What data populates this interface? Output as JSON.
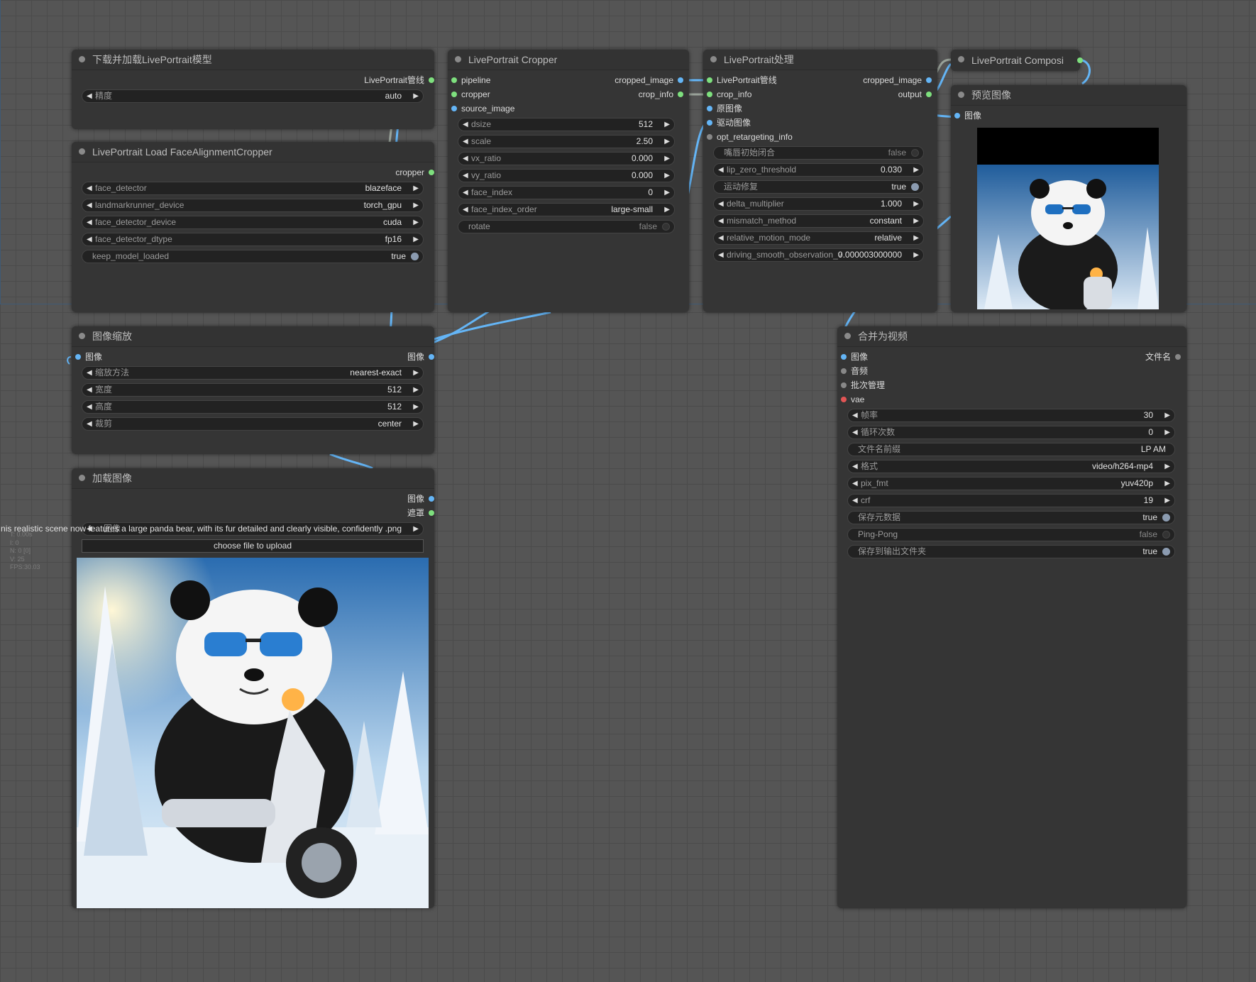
{
  "nodes": {
    "loader": {
      "title": "下载并加载LivePortrait模型",
      "output": "LivePortrait管线",
      "precision": {
        "label": "精度",
        "value": "auto"
      }
    },
    "face_cropper": {
      "title": "LivePortrait Load FaceAlignmentCropper",
      "output": "cropper",
      "face_detector": {
        "label": "face_detector",
        "value": "blazeface"
      },
      "landmarkrunner_device": {
        "label": "landmarkrunner_device",
        "value": "torch_gpu"
      },
      "face_detector_device": {
        "label": "face_detector_device",
        "value": "cuda"
      },
      "face_detector_dtype": {
        "label": "face_detector_dtype",
        "value": "fp16"
      },
      "keep_model_loaded": {
        "label": "keep_model_loaded",
        "value": "true"
      }
    },
    "cropper": {
      "title": "LivePortrait Cropper",
      "in_pipeline": "pipeline",
      "in_cropper": "cropper",
      "in_source_image": "source_image",
      "out_cropped_image": "cropped_image",
      "out_crop_info": "crop_info",
      "dsize": {
        "label": "dsize",
        "value": "512"
      },
      "scale": {
        "label": "scale",
        "value": "2.50"
      },
      "vx_ratio": {
        "label": "vx_ratio",
        "value": "0.000"
      },
      "vy_ratio": {
        "label": "vy_ratio",
        "value": "0.000"
      },
      "face_index": {
        "label": "face_index",
        "value": "0"
      },
      "face_index_order": {
        "label": "face_index_order",
        "value": "large-small"
      },
      "rotate": {
        "label": "rotate",
        "value": "false"
      }
    },
    "process": {
      "title": "LivePortrait处理",
      "in_pipeline": "LivePortrait管线",
      "in_crop_info": "crop_info",
      "in_source": "原图像",
      "in_driving": "驱动图像",
      "in_opt": "opt_retargeting_info",
      "out_cropped_image": "cropped_image",
      "out_output": "output",
      "lip_init": {
        "label": "嘴唇初始闭合",
        "value": "false"
      },
      "lip_zero_threshold": {
        "label": "lip_zero_threshold",
        "value": "0.030"
      },
      "motion_repair": {
        "label": "运动修复",
        "value": "true"
      },
      "delta_multiplier": {
        "label": "delta_multiplier",
        "value": "1.000"
      },
      "mismatch_method": {
        "label": "mismatch_method",
        "value": "constant"
      },
      "relative_motion_mode": {
        "label": "relative_motion_mode",
        "value": "relative"
      },
      "driving_smooth": {
        "label": "driving_smooth_observation_v",
        "value": "0.000003000000"
      }
    },
    "composite": {
      "title": "LivePortrait Composi"
    },
    "preview": {
      "title": "预览图像",
      "input": "图像"
    },
    "resize": {
      "title": "图像缩放",
      "input": "图像",
      "output": "图像",
      "method": {
        "label": "缩放方法",
        "value": "nearest-exact"
      },
      "width": {
        "label": "宽度",
        "value": "512"
      },
      "height": {
        "label": "高度",
        "value": "512"
      },
      "crop": {
        "label": "裁剪",
        "value": "center"
      }
    },
    "load_image": {
      "title": "加载图像",
      "out_image": "图像",
      "out_mask": "遮罩",
      "image_value": "nis realistic scene now features a large panda bear, with its fur detailed and clearly visible, confidently .png",
      "image_label": "图像",
      "upload": "choose file to upload"
    },
    "video": {
      "title": "合并为视频",
      "in_image": "图像",
      "in_audio": "音频",
      "in_batch": "批次管理",
      "in_vae": "vae",
      "out_filename": "文件名",
      "frame_rate": {
        "label": "帧率",
        "value": "30"
      },
      "loop_count": {
        "label": "循环次数",
        "value": "0"
      },
      "filename_prefix": {
        "label": "文件名前缀",
        "value": "LP AM"
      },
      "format": {
        "label": "格式",
        "value": "video/h264-mp4"
      },
      "pix_fmt": {
        "label": "pix_fmt",
        "value": "yuv420p"
      },
      "crf": {
        "label": "crf",
        "value": "19"
      },
      "save_metadata": {
        "label": "保存元数据",
        "value": "true"
      },
      "pingpong": {
        "label": "Ping-Pong",
        "value": "false"
      },
      "save_output": {
        "label": "保存到输出文件夹",
        "value": "true"
      }
    }
  },
  "stats": [
    "T: 0.00s",
    "I: 0",
    "N: 0 [0]",
    "V: 25",
    "FPS:30.03"
  ],
  "colors": {
    "link_blue": "#64b5f6",
    "link_gray": "#9aa39a",
    "slot_green": "#7ee07e",
    "slot_blue": "#64b5f6",
    "slot_red": "#e25555",
    "slot_gray": "#888888"
  }
}
